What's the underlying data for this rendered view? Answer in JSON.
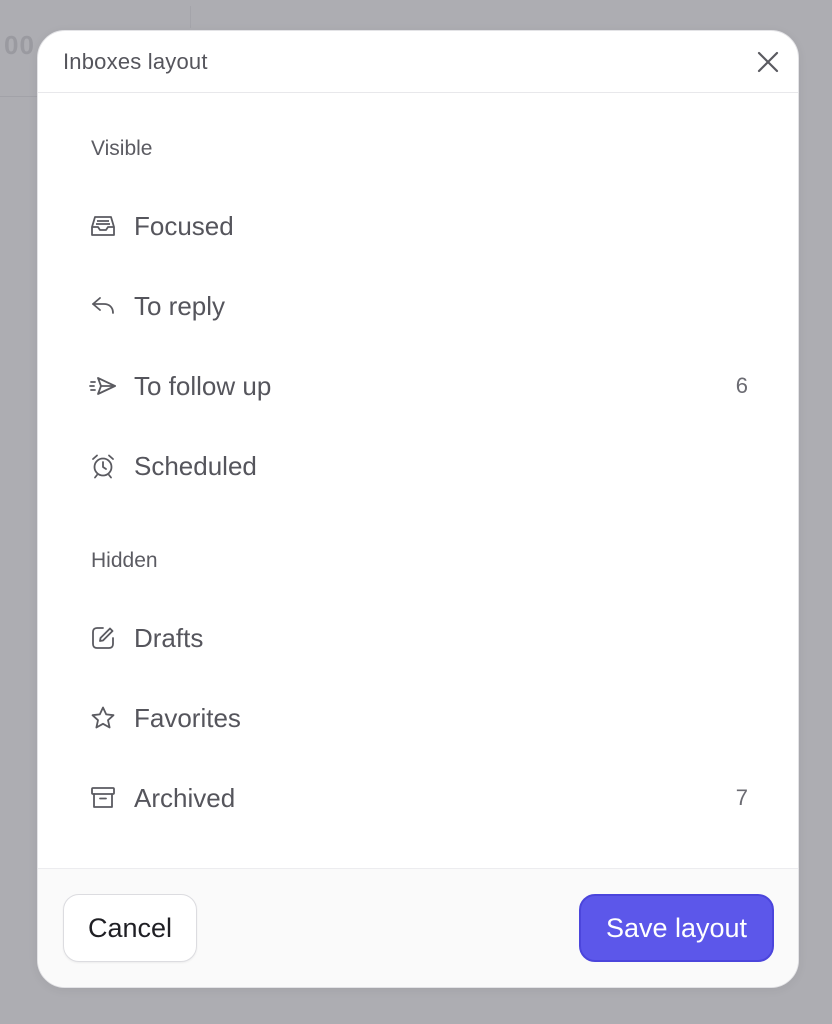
{
  "dialog": {
    "title": "Inboxes layout"
  },
  "sections": {
    "visible": {
      "label": "Visible",
      "items": [
        {
          "label": "Focused",
          "icon": "inbox-tray-icon",
          "count": ""
        },
        {
          "label": "To reply",
          "icon": "reply-arrow-icon",
          "count": ""
        },
        {
          "label": "To follow up",
          "icon": "paper-plane-fast-icon",
          "count": "6"
        },
        {
          "label": "Scheduled",
          "icon": "alarm-clock-icon",
          "count": ""
        }
      ]
    },
    "hidden": {
      "label": "Hidden",
      "items": [
        {
          "label": "Drafts",
          "icon": "pencil-square-icon",
          "count": ""
        },
        {
          "label": "Favorites",
          "icon": "star-icon",
          "count": ""
        },
        {
          "label": "Archived",
          "icon": "archive-box-icon",
          "count": "7"
        }
      ]
    }
  },
  "footer": {
    "cancel_label": "Cancel",
    "save_label": "Save layout"
  },
  "colors": {
    "accent": "#5c57ea",
    "overlay": "#adadb2",
    "text": "#55555c"
  }
}
